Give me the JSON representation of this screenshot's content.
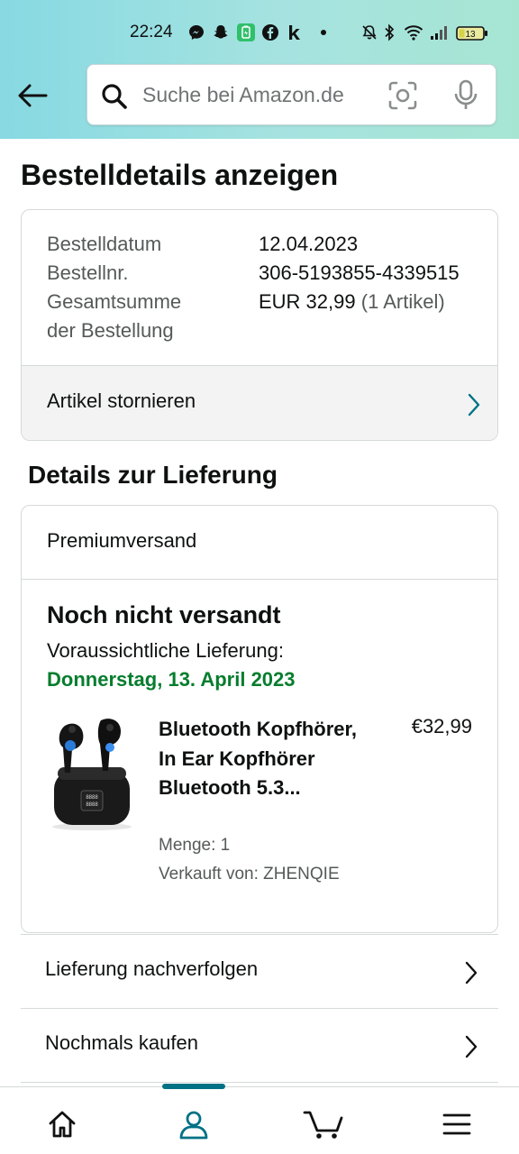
{
  "statusbar": {
    "time": "22:24",
    "battery": "13",
    "icons": [
      "messenger-icon",
      "snapchat-icon",
      "battery-saver-icon",
      "facebook-icon",
      "k-icon",
      "dot-icon",
      "mute-icon",
      "bluetooth-icon",
      "wifi-icon",
      "signal-icon",
      "battery-icon"
    ]
  },
  "search": {
    "placeholder": "Suche bei Amazon.de"
  },
  "page": {
    "title": "Bestelldetails anzeigen"
  },
  "order": {
    "date_label": "Bestelldatum",
    "date_value": "12.04.2023",
    "number_label": "Bestellnr.",
    "number_value": "306-5193855-4339515",
    "total_label_line1": "Gesamtsumme",
    "total_label_line2": "der Bestellung",
    "total_value": "EUR 32,99",
    "total_items": "(1 Artikel)",
    "cancel_label": "Artikel stornieren"
  },
  "delivery": {
    "section_title": "Details zur Lieferung",
    "shipping_method": "Premiumversand",
    "status": "Noch nicht versandt",
    "expected_label": "Voraussichtliche Lieferung:",
    "expected_date": "Donnerstag, 13. April 2023",
    "product": {
      "title": "Bluetooth Kopfhörer, In Ear Kopfhörer Bluetooth 5.3...",
      "price": "€32,99",
      "quantity": "Menge: 1",
      "seller": "Verkauft von: ZHENQIE"
    }
  },
  "actions": {
    "track": "Lieferung nachverfolgen",
    "buy_again": "Nochmals kaufen"
  },
  "bottom_nav": {
    "items": [
      "home-icon",
      "account-icon",
      "cart-icon",
      "menu-icon"
    ],
    "active": "account-icon",
    "accent_color": "#007185"
  },
  "colors": {
    "green": "#067d2e",
    "accent": "#007185"
  }
}
